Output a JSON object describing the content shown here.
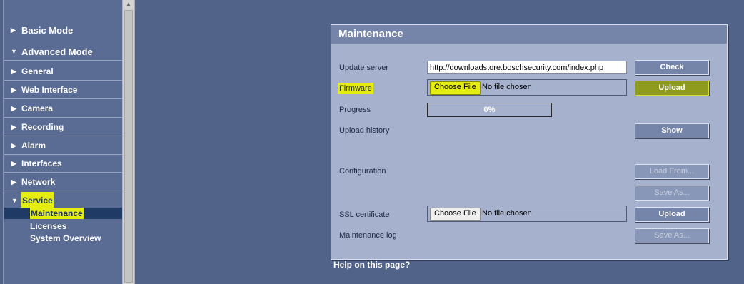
{
  "sidebar": {
    "basic_mode": "Basic Mode",
    "advanced_mode": "Advanced Mode",
    "items": [
      {
        "label": "General"
      },
      {
        "label": "Web Interface"
      },
      {
        "label": "Camera"
      },
      {
        "label": "Recording"
      },
      {
        "label": "Alarm"
      },
      {
        "label": "Interfaces"
      },
      {
        "label": "Network"
      },
      {
        "label": "Service"
      }
    ],
    "service_subitems": [
      {
        "label": "Maintenance"
      },
      {
        "label": "Licenses"
      },
      {
        "label": "System Overview"
      }
    ]
  },
  "panel": {
    "title": "Maintenance",
    "update_server_label": "Update server",
    "update_server_value": "http://downloadstore.boschsecurity.com/index.php",
    "check_button": "Check",
    "firmware_label": "Firmware",
    "choose_file": "Choose File",
    "no_file": "No file chosen",
    "upload_button": "Upload",
    "progress_label": "Progress",
    "progress_value": "0%",
    "upload_history_label": "Upload history",
    "show_button": "Show",
    "configuration_label": "Configuration",
    "load_from_button": "Load From...",
    "save_as_button": "Save As...",
    "ssl_label": "SSL certificate",
    "ssl_choose_file": "Choose File",
    "ssl_no_file": "No file chosen",
    "ssl_upload_button": "Upload",
    "maintenance_log_label": "Maintenance log",
    "log_save_as_button": "Save As..."
  },
  "help_link": "Help on this page?",
  "colors": {
    "background": "#52638a",
    "panel": "#a6b2cd",
    "panel_header": "#7585a9",
    "highlight": "#e5ec0f",
    "selected_nav": "#1f3a64"
  }
}
